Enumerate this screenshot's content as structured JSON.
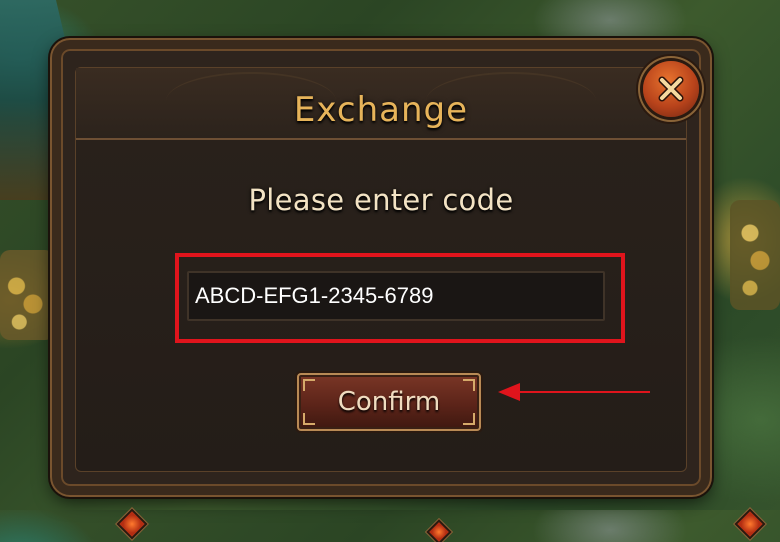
{
  "dialog": {
    "title": "Exchange",
    "close_icon": "close-x-icon",
    "prompt": "Please enter code",
    "code_input": {
      "value": "ABCD-EFG1-2345-6789",
      "placeholder": ""
    },
    "confirm_label": "Confirm"
  },
  "annotation": {
    "highlight_color": "#e0141c",
    "arrow_color": "#e0141c",
    "arrow_icon": "arrow-left-icon"
  },
  "colors": {
    "title": "#e7b45a",
    "close_button": "#c4501f",
    "confirm_button": "#5c2419",
    "panel": "#2e241d"
  }
}
